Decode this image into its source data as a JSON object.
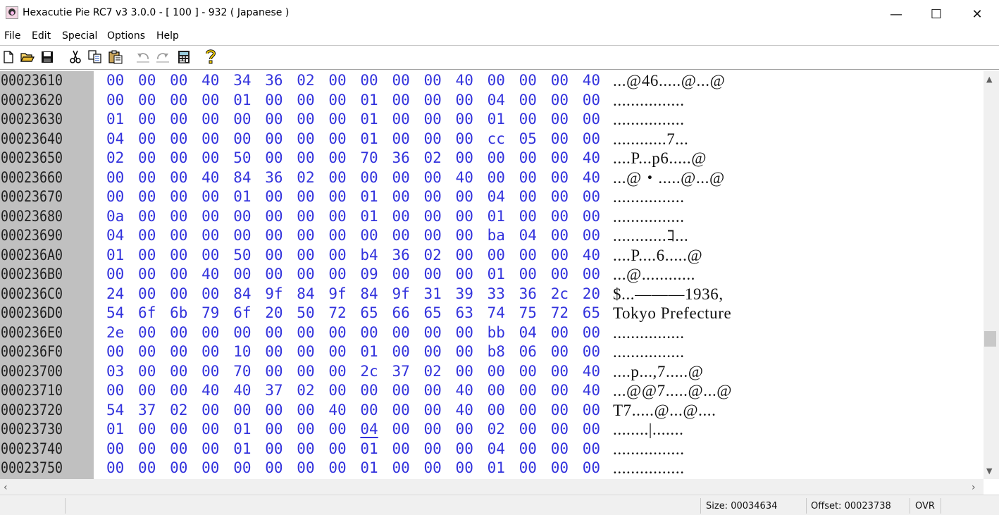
{
  "window": {
    "title": "Hexacutie Pie RC7 v3 3.0.0 - [ 100 ] - 932 ( Japanese )",
    "app_icon": "hexacutie-app-icon",
    "controls": {
      "minimize": "—",
      "maximize": "☐",
      "close": "✕"
    }
  },
  "menu": [
    "File",
    "Edit",
    "Special",
    "Options",
    "Help"
  ],
  "toolbar": [
    {
      "name": "new-file-icon",
      "glyph": "🗋"
    },
    {
      "name": "open-folder-icon",
      "glyph": "📂"
    },
    {
      "name": "save-icon",
      "glyph": "💾"
    },
    {
      "name": "cut-icon",
      "glyph": "✂"
    },
    {
      "name": "copy-icon",
      "glyph": "⧉"
    },
    {
      "name": "paste-icon",
      "glyph": "📋"
    },
    {
      "name": "undo-icon",
      "glyph": "↶"
    },
    {
      "name": "redo-icon",
      "glyph": "↷"
    },
    {
      "name": "calculator-icon",
      "glyph": "▦"
    },
    {
      "name": "help-icon",
      "glyph": "?"
    }
  ],
  "hex_rows": [
    {
      "offset": "00023610",
      "bytes": [
        "00",
        "00",
        "00",
        "40",
        "34",
        "36",
        "02",
        "00",
        "00",
        "00",
        "00",
        "40",
        "00",
        "00",
        "00",
        "40"
      ],
      "ascii": "...@46.....@...@"
    },
    {
      "offset": "00023620",
      "bytes": [
        "00",
        "00",
        "00",
        "00",
        "01",
        "00",
        "00",
        "00",
        "01",
        "00",
        "00",
        "00",
        "04",
        "00",
        "00",
        "00"
      ],
      "ascii": "................"
    },
    {
      "offset": "00023630",
      "bytes": [
        "01",
        "00",
        "00",
        "00",
        "00",
        "00",
        "00",
        "00",
        "01",
        "00",
        "00",
        "00",
        "01",
        "00",
        "00",
        "00"
      ],
      "ascii": "................"
    },
    {
      "offset": "00023640",
      "bytes": [
        "04",
        "00",
        "00",
        "00",
        "00",
        "00",
        "00",
        "00",
        "01",
        "00",
        "00",
        "00",
        "cc",
        "05",
        "00",
        "00"
      ],
      "ascii": "............7..."
    },
    {
      "offset": "00023650",
      "bytes": [
        "02",
        "00",
        "00",
        "00",
        "50",
        "00",
        "00",
        "00",
        "70",
        "36",
        "02",
        "00",
        "00",
        "00",
        "00",
        "40"
      ],
      "ascii": "....P...p6.....@"
    },
    {
      "offset": "00023660",
      "bytes": [
        "00",
        "00",
        "00",
        "40",
        "84",
        "36",
        "02",
        "00",
        "00",
        "00",
        "00",
        "40",
        "00",
        "00",
        "00",
        "40"
      ],
      "ascii": "...@・.....@...@"
    },
    {
      "offset": "00023670",
      "bytes": [
        "00",
        "00",
        "00",
        "00",
        "01",
        "00",
        "00",
        "00",
        "01",
        "00",
        "00",
        "00",
        "04",
        "00",
        "00",
        "00"
      ],
      "ascii": "................"
    },
    {
      "offset": "00023680",
      "bytes": [
        "0a",
        "00",
        "00",
        "00",
        "00",
        "00",
        "00",
        "00",
        "01",
        "00",
        "00",
        "00",
        "01",
        "00",
        "00",
        "00"
      ],
      "ascii": "................"
    },
    {
      "offset": "00023690",
      "bytes": [
        "04",
        "00",
        "00",
        "00",
        "00",
        "00",
        "00",
        "00",
        "00",
        "00",
        "00",
        "00",
        "ba",
        "04",
        "00",
        "00"
      ],
      "ascii": "............ｺ..."
    },
    {
      "offset": "000236A0",
      "bytes": [
        "01",
        "00",
        "00",
        "00",
        "50",
        "00",
        "00",
        "00",
        "b4",
        "36",
        "02",
        "00",
        "00",
        "00",
        "00",
        "40"
      ],
      "ascii": "....P....6.....@"
    },
    {
      "offset": "000236B0",
      "bytes": [
        "00",
        "00",
        "00",
        "40",
        "00",
        "00",
        "00",
        "00",
        "09",
        "00",
        "00",
        "00",
        "01",
        "00",
        "00",
        "00"
      ],
      "ascii": "...@............"
    },
    {
      "offset": "000236C0",
      "bytes": [
        "24",
        "00",
        "00",
        "00",
        "84",
        "9f",
        "84",
        "9f",
        "84",
        "9f",
        "31",
        "39",
        "33",
        "36",
        "2c",
        "20"
      ],
      "ascii": "$...———1936, "
    },
    {
      "offset": "000236D0",
      "bytes": [
        "54",
        "6f",
        "6b",
        "79",
        "6f",
        "20",
        "50",
        "72",
        "65",
        "66",
        "65",
        "63",
        "74",
        "75",
        "72",
        "65"
      ],
      "ascii": "Tokyo Prefecture"
    },
    {
      "offset": "000236E0",
      "bytes": [
        "2e",
        "00",
        "00",
        "00",
        "00",
        "00",
        "00",
        "00",
        "00",
        "00",
        "00",
        "00",
        "bb",
        "04",
        "00",
        "00"
      ],
      "ascii": "................"
    },
    {
      "offset": "000236F0",
      "bytes": [
        "00",
        "00",
        "00",
        "00",
        "10",
        "00",
        "00",
        "00",
        "01",
        "00",
        "00",
        "00",
        "b8",
        "06",
        "00",
        "00"
      ],
      "ascii": "................"
    },
    {
      "offset": "00023700",
      "bytes": [
        "03",
        "00",
        "00",
        "00",
        "70",
        "00",
        "00",
        "00",
        "2c",
        "37",
        "02",
        "00",
        "00",
        "00",
        "00",
        "40"
      ],
      "ascii": "....p...,7.....@"
    },
    {
      "offset": "00023710",
      "bytes": [
        "00",
        "00",
        "00",
        "40",
        "40",
        "37",
        "02",
        "00",
        "00",
        "00",
        "00",
        "40",
        "00",
        "00",
        "00",
        "40"
      ],
      "ascii": "...@@7.....@...@"
    },
    {
      "offset": "00023720",
      "bytes": [
        "54",
        "37",
        "02",
        "00",
        "00",
        "00",
        "00",
        "40",
        "00",
        "00",
        "00",
        "40",
        "00",
        "00",
        "00",
        "00"
      ],
      "ascii": "T7.....@...@...."
    },
    {
      "offset": "00023730",
      "bytes": [
        "01",
        "00",
        "00",
        "00",
        "01",
        "00",
        "00",
        "00",
        "04",
        "00",
        "00",
        "00",
        "02",
        "00",
        "00",
        "00"
      ],
      "ascii": "........|......."
    },
    {
      "offset": "00023740",
      "bytes": [
        "00",
        "00",
        "00",
        "00",
        "01",
        "00",
        "00",
        "00",
        "01",
        "00",
        "00",
        "00",
        "04",
        "00",
        "00",
        "00"
      ],
      "ascii": "................"
    },
    {
      "offset": "00023750",
      "bytes": [
        "00",
        "00",
        "00",
        "00",
        "00",
        "00",
        "00",
        "00",
        "01",
        "00",
        "00",
        "00",
        "01",
        "00",
        "00",
        "00"
      ],
      "ascii": "................"
    }
  ],
  "cursor": {
    "row": 18,
    "col": 8
  },
  "status": {
    "size": "Size: 00034634",
    "offset": "Offset: 00023738",
    "mode": "OVR"
  }
}
